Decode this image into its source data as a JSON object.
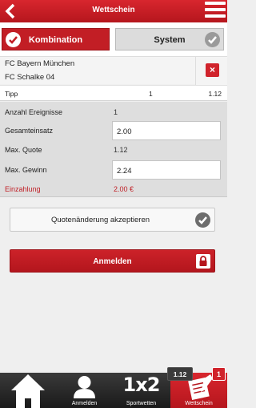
{
  "header": {
    "title": "Wettschein"
  },
  "tabs": [
    {
      "label": "Kombination",
      "active": true
    },
    {
      "label": "System",
      "active": false
    }
  ],
  "match": {
    "team_home": "FC Bayern München",
    "team_away": "FC Schalke 04",
    "remove_symbol": "×"
  },
  "tip": {
    "label": "Tipp",
    "pick": "1",
    "quote": "1.12"
  },
  "summary": {
    "events_label": "Anzahl Ereignisse",
    "events_value": "1",
    "stake_label": "Gesamteinsatz",
    "stake_value": "2.00",
    "max_quote_label": "Max. Quote",
    "max_quote_value": "1.12",
    "max_win_label": "Max. Gewinn",
    "max_win_value": "2.24",
    "deposit_label": "Einzahlung",
    "deposit_value": "2.00 €"
  },
  "odds_change": {
    "label": "Quotenänderung akzeptieren"
  },
  "login_button": {
    "label": "Anmelden"
  },
  "bottom_nav": {
    "home_icon": "home-icon",
    "login_label": "Anmelden",
    "sports_label": "Sportwetten",
    "sports_glyph": "1x2",
    "slip_label": "Wettschein",
    "odds_badge": "1.12",
    "count_badge": "1"
  },
  "colors": {
    "accent": "#c21e25",
    "nav_bg": "#2a2a2a",
    "panel_bg": "#dedede"
  }
}
